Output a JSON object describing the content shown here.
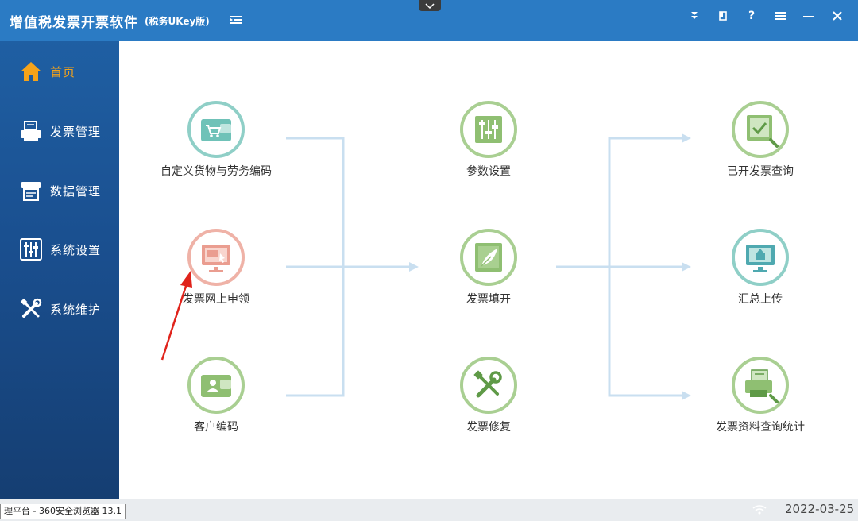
{
  "app": {
    "title": "增值税发票开票软件",
    "subtitle": "(税务UKey版)"
  },
  "sidebar": {
    "items": [
      {
        "label": "首页",
        "icon": "home-icon",
        "active": true
      },
      {
        "label": "发票管理",
        "icon": "printer-icon",
        "active": false
      },
      {
        "label": "数据管理",
        "icon": "data-icon",
        "active": false
      },
      {
        "label": "系统设置",
        "icon": "sliders-icon",
        "active": false
      },
      {
        "label": "系统维护",
        "icon": "tools-icon",
        "active": false
      }
    ]
  },
  "workflow": {
    "nodes": [
      {
        "label": "自定义货物与劳务编码",
        "icon": "cart-wallet-icon",
        "ring": "teal"
      },
      {
        "label": "发票网上申领",
        "icon": "monitor-apply-icon",
        "ring": "red"
      },
      {
        "label": "客户编码",
        "icon": "customer-wallet-icon",
        "ring": "green"
      },
      {
        "label": "参数设置",
        "icon": "parameter-sliders-icon",
        "ring": "green"
      },
      {
        "label": "发票填开",
        "icon": "invoice-fill-icon",
        "ring": "green"
      },
      {
        "label": "发票修复",
        "icon": "invoice-repair-icon",
        "ring": "green"
      },
      {
        "label": "已开发票查询",
        "icon": "issued-invoice-search-icon",
        "ring": "green"
      },
      {
        "label": "汇总上传",
        "icon": "summary-upload-icon",
        "ring": "teal"
      },
      {
        "label": "发票资料查询统计",
        "icon": "invoice-stats-search-icon",
        "ring": "green"
      }
    ]
  },
  "statusbar": {
    "browser_tip": "理平台 - 360安全浏览器 13.1",
    "date": "2022-03-25"
  },
  "colors": {
    "titlebar": "#2b7bc4",
    "sidebar": "#1a4f8f",
    "active": "#f5a31a",
    "flow_line": "#c9dff0",
    "annotation_arrow": "#e0231b"
  }
}
